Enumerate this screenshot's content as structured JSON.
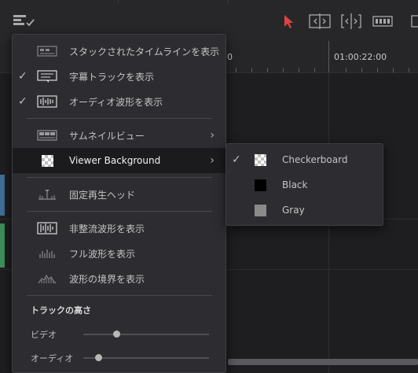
{
  "ruler": {
    "timecode_partial": "0",
    "timecode": "01:00:22:00"
  },
  "menu": {
    "items": [
      {
        "label": "スタックされたタイムラインを表示",
        "checked": false,
        "icon": "stacked-timelines-icon"
      },
      {
        "label": "字幕トラックを表示",
        "checked": true,
        "icon": "subtitle-track-icon"
      },
      {
        "label": "オーディオ波形を表示",
        "checked": true,
        "icon": "audio-waveform-icon"
      },
      {
        "label": "サムネイルビュー",
        "checked": false,
        "icon": "thumbnail-view-icon",
        "submenu": true
      },
      {
        "label": "Viewer Background",
        "checked": false,
        "icon": "checkerboard-icon",
        "submenu": true,
        "highlighted": true
      },
      {
        "label": "固定再生ヘッド",
        "checked": false,
        "icon": "fixed-playhead-icon"
      },
      {
        "label": "非整流波形を表示",
        "checked": false,
        "icon": "unrectified-waveform-icon"
      },
      {
        "label": "フル波形を表示",
        "checked": false,
        "icon": "full-waveform-icon"
      },
      {
        "label": "波形の境界を表示",
        "checked": false,
        "icon": "waveform-border-icon"
      }
    ],
    "check_glyph": "✓",
    "arrow_glyph": "›",
    "track_height": {
      "title": "トラックの高さ",
      "video_label": "ビデオ",
      "audio_label": "オーディオ",
      "video_value": 0.26,
      "audio_value": 0.12
    }
  },
  "submenu": {
    "items": [
      {
        "label": "Checkerboard",
        "checked": true,
        "swatch": "checkerboard"
      },
      {
        "label": "Black",
        "checked": false,
        "swatch": "#000000"
      },
      {
        "label": "Gray",
        "checked": false,
        "swatch": "#8a8a8a"
      }
    ]
  },
  "colors": {
    "select_tool": "#e0443e",
    "menu_bg": "#2d2d31",
    "highlight_bg": "#1b1b1e"
  }
}
